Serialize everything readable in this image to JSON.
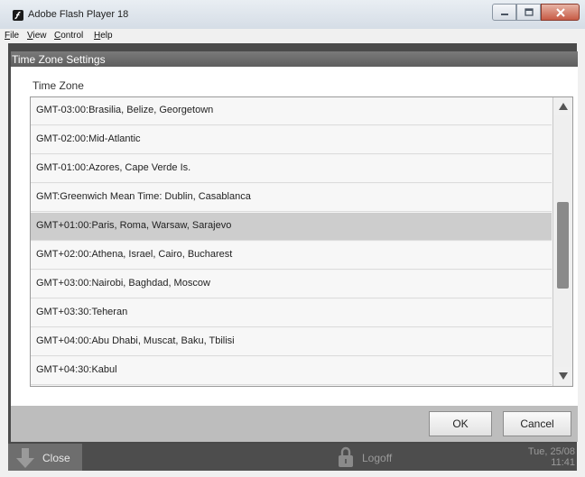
{
  "window": {
    "title": "Adobe Flash Player 18"
  },
  "menu": {
    "items": [
      "File",
      "View",
      "Control",
      "Help"
    ]
  },
  "dialog": {
    "title": "Time Zone Settings",
    "field_label": "Time Zone",
    "timezones": [
      "GMT-03:00:Brasilia, Belize, Georgetown",
      "GMT-02:00:Mid-Atlantic",
      "GMT-01:00:Azores, Cape Verde Is.",
      "GMT:Greenwich Mean Time: Dublin, Casablanca",
      "GMT+01:00:Paris, Roma, Warsaw, Sarajevo",
      "GMT+02:00:Athena, Israel, Cairo, Bucharest",
      "GMT+03:00:Nairobi, Baghdad, Moscow",
      "GMT+03:30:Teheran",
      "GMT+04:00:Abu Dhabi, Muscat, Baku, Tbilisi",
      "GMT+04:30:Kabul"
    ],
    "selected_index": 4,
    "ok_label": "OK",
    "cancel_label": "Cancel"
  },
  "bottom_bar": {
    "close_label": "Close",
    "logoff_label": "Logoff",
    "date": "Tue, 25/08",
    "time": "11:41"
  }
}
